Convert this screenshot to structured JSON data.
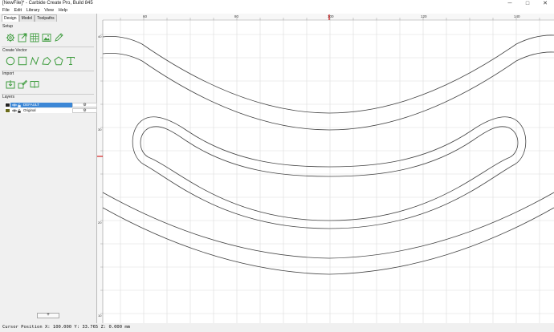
{
  "window": {
    "title": "[NewFile]* - Carbide Create Pro, Build 845",
    "minimize": "─",
    "maximize": "□",
    "close": "✕"
  },
  "menu": [
    {
      "label": "File"
    },
    {
      "label": "Edit"
    },
    {
      "label": "Library"
    },
    {
      "label": "View"
    },
    {
      "label": "Help"
    }
  ],
  "tabs": [
    {
      "label": "Design"
    },
    {
      "label": "Model"
    },
    {
      "label": "Toolpaths"
    }
  ],
  "active_tab": "Design",
  "sections": {
    "setup": "Setup",
    "create_vector": "Create Vector",
    "import": "Import",
    "layers": "Layers"
  },
  "setup_icons": [
    "gear-icon",
    "export-icon",
    "grid-icon",
    "image-icon",
    "pencil-icon"
  ],
  "vector_icons": [
    "circle-icon",
    "rectangle-icon",
    "curve-icon",
    "polygon-icon",
    "pentagon-icon",
    "text-icon"
  ],
  "import_icons": [
    "import-icon",
    "edit-image-icon",
    "open-book-icon"
  ],
  "layers": [
    {
      "name": "DEFAULT",
      "color": "#222222",
      "selected": true,
      "action": "⚙"
    },
    {
      "name": "Original",
      "color": "#6b6b1a",
      "selected": false,
      "action": "⚙"
    }
  ],
  "add_layer_label": "+",
  "ruler": {
    "top_labels": [
      "60",
      "80",
      "100",
      "120",
      "140"
    ],
    "left_labels": [
      "40",
      "30",
      "20",
      "10"
    ]
  },
  "colors": {
    "accent": "#3c87d6",
    "design": "#3c9b3c",
    "ruler_marker": "#d62020"
  },
  "status": {
    "cursor_text": "Cursor Position X: 100.000 Y: 33.765 Z: 0.000 mm"
  }
}
